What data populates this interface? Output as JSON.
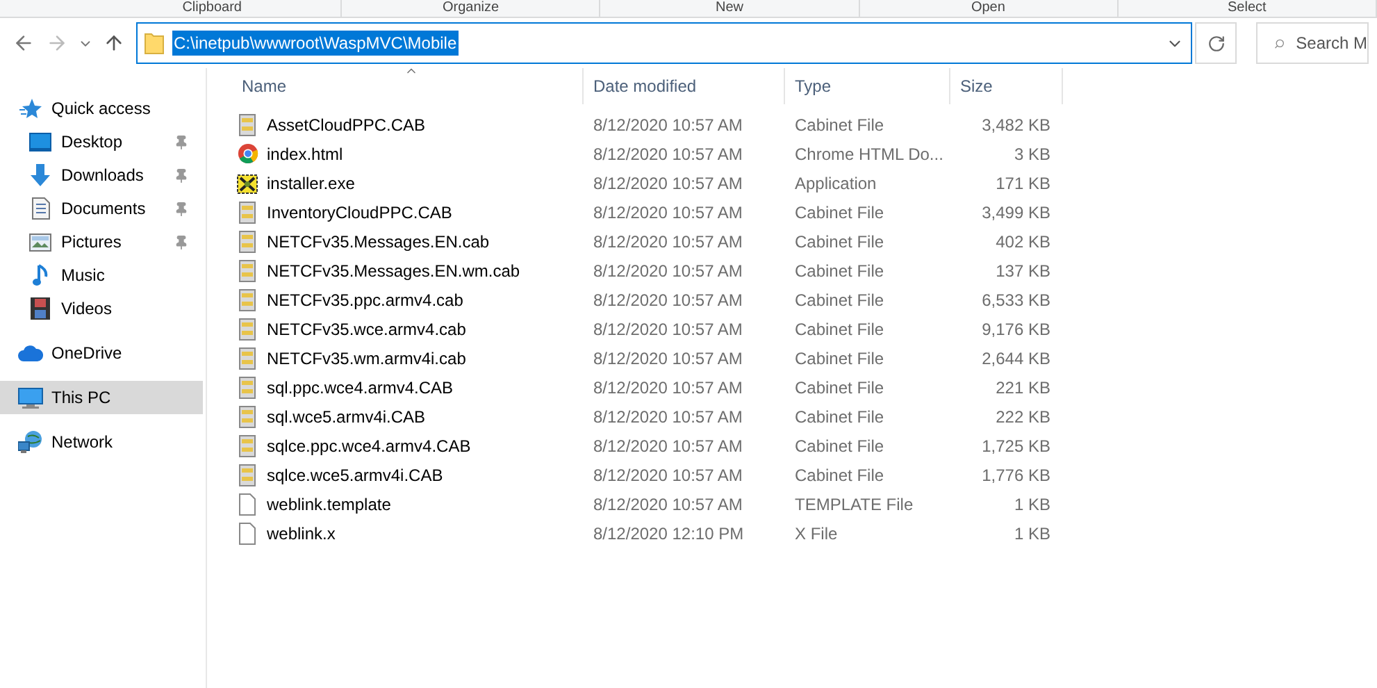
{
  "ribbon_groups": [
    "Clipboard",
    "Organize",
    "New",
    "Open",
    "Select"
  ],
  "address_bar": {
    "path": "C:\\inetpub\\wwwroot\\WaspMVC\\Mobile",
    "selected": true
  },
  "search": {
    "placeholder": "Search M"
  },
  "sidebar": {
    "items": [
      {
        "label": "Quick access",
        "kind": "star",
        "selected": false,
        "children": [
          {
            "label": "Desktop",
            "kind": "desktop",
            "pinned": true,
            "selected": false
          },
          {
            "label": "Downloads",
            "kind": "download",
            "pinned": true,
            "selected": false
          },
          {
            "label": "Documents",
            "kind": "document",
            "pinned": true,
            "selected": false
          },
          {
            "label": "Pictures",
            "kind": "picture",
            "pinned": true,
            "selected": false
          },
          {
            "label": "Music",
            "kind": "music",
            "pinned": false,
            "selected": false
          },
          {
            "label": "Videos",
            "kind": "video",
            "pinned": false,
            "selected": false
          }
        ]
      },
      {
        "label": "OneDrive",
        "kind": "cloud",
        "selected": false
      },
      {
        "label": "This PC",
        "kind": "pc",
        "selected": true
      },
      {
        "label": "Network",
        "kind": "network",
        "selected": false
      }
    ]
  },
  "table": {
    "columns": [
      "Name",
      "Date modified",
      "Type",
      "Size"
    ],
    "rows": [
      {
        "kind": "cab",
        "name": "AssetCloudPPC.CAB",
        "date": "8/12/2020 10:57 AM",
        "type": "Cabinet File",
        "size": "3,482 KB"
      },
      {
        "kind": "chrome",
        "name": "index.html",
        "date": "8/12/2020 10:57 AM",
        "type": "Chrome HTML Do...",
        "size": "3 KB"
      },
      {
        "kind": "exe",
        "name": "installer.exe",
        "date": "8/12/2020 10:57 AM",
        "type": "Application",
        "size": "171 KB"
      },
      {
        "kind": "cab",
        "name": "InventoryCloudPPC.CAB",
        "date": "8/12/2020 10:57 AM",
        "type": "Cabinet File",
        "size": "3,499 KB"
      },
      {
        "kind": "cab",
        "name": "NETCFv35.Messages.EN.cab",
        "date": "8/12/2020 10:57 AM",
        "type": "Cabinet File",
        "size": "402 KB"
      },
      {
        "kind": "cab",
        "name": "NETCFv35.Messages.EN.wm.cab",
        "date": "8/12/2020 10:57 AM",
        "type": "Cabinet File",
        "size": "137 KB"
      },
      {
        "kind": "cab",
        "name": "NETCFv35.ppc.armv4.cab",
        "date": "8/12/2020 10:57 AM",
        "type": "Cabinet File",
        "size": "6,533 KB"
      },
      {
        "kind": "cab",
        "name": "NETCFv35.wce.armv4.cab",
        "date": "8/12/2020 10:57 AM",
        "type": "Cabinet File",
        "size": "9,176 KB"
      },
      {
        "kind": "cab",
        "name": "NETCFv35.wm.armv4i.cab",
        "date": "8/12/2020 10:57 AM",
        "type": "Cabinet File",
        "size": "2,644 KB"
      },
      {
        "kind": "cab",
        "name": "sql.ppc.wce4.armv4.CAB",
        "date": "8/12/2020 10:57 AM",
        "type": "Cabinet File",
        "size": "221 KB"
      },
      {
        "kind": "cab",
        "name": "sql.wce5.armv4i.CAB",
        "date": "8/12/2020 10:57 AM",
        "type": "Cabinet File",
        "size": "222 KB"
      },
      {
        "kind": "cab",
        "name": "sqlce.ppc.wce4.armv4.CAB",
        "date": "8/12/2020 10:57 AM",
        "type": "Cabinet File",
        "size": "1,725 KB"
      },
      {
        "kind": "cab",
        "name": "sqlce.wce5.armv4i.CAB",
        "date": "8/12/2020 10:57 AM",
        "type": "Cabinet File",
        "size": "1,776 KB"
      },
      {
        "kind": "blank",
        "name": "weblink.template",
        "date": "8/12/2020 10:57 AM",
        "type": "TEMPLATE File",
        "size": "1 KB"
      },
      {
        "kind": "blank",
        "name": "weblink.x",
        "date": "8/12/2020 12:10 PM",
        "type": "X File",
        "size": "1 KB"
      }
    ]
  }
}
